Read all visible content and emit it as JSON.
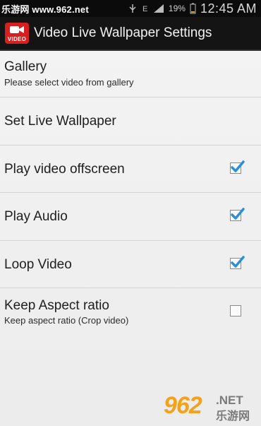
{
  "status_bar": {
    "watermark": "乐游网 www.962.net",
    "battery_pct": "19%",
    "time": "12:45 AM"
  },
  "action_bar": {
    "icon_label": "VIDEO",
    "title": "Video Live Wallpaper Settings"
  },
  "preferences": [
    {
      "title": "Gallery",
      "summary": "Please select video from gallery",
      "checkbox": null
    },
    {
      "title": "Set Live Wallpaper",
      "summary": null,
      "checkbox": null
    },
    {
      "title": "Play video offscreen",
      "summary": null,
      "checkbox": true
    },
    {
      "title": "Play Audio",
      "summary": null,
      "checkbox": true
    },
    {
      "title": "Loop Video",
      "summary": null,
      "checkbox": true
    },
    {
      "title": "Keep Aspect ratio",
      "summary": "Keep aspect ratio (Crop video)",
      "checkbox": false
    }
  ],
  "watermark_logo": {
    "number": "962",
    "net": ".NET",
    "cn": "乐游网"
  },
  "colors": {
    "accent_check": "#2b8fd6",
    "app_icon": "#d62020",
    "status_bar": "#0b0b0b"
  }
}
